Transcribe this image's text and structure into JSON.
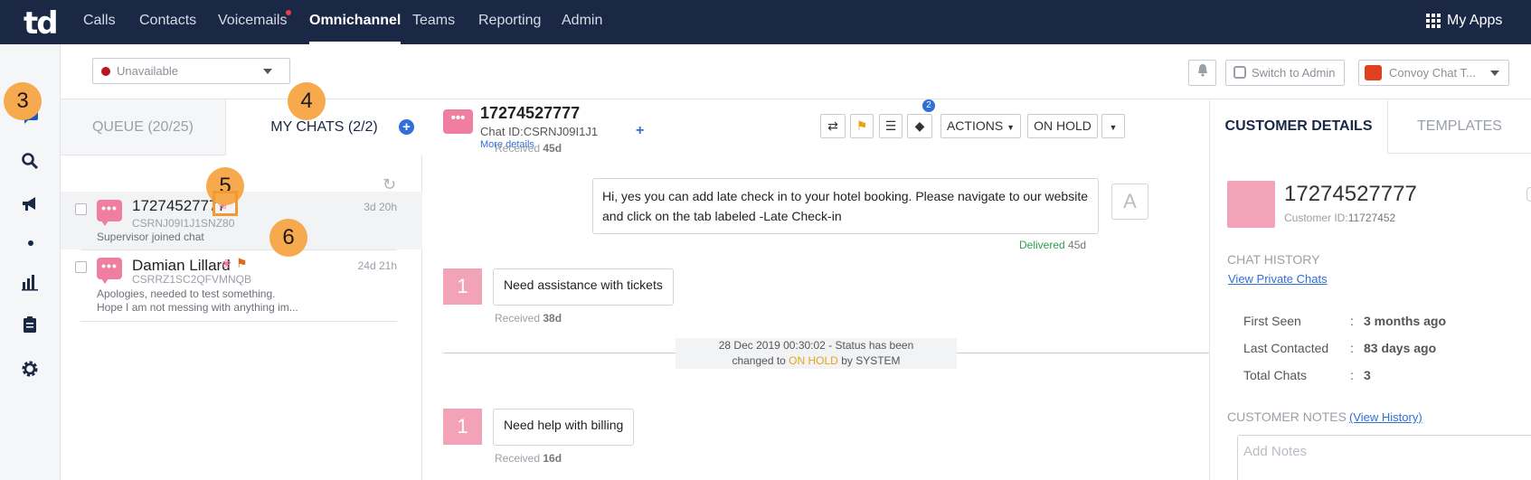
{
  "logo": "td",
  "nav": {
    "items": [
      "Calls",
      "Contacts",
      "Voicemails",
      "Omnichannel",
      "Teams",
      "Reporting",
      "Admin"
    ],
    "active": "Omnichannel",
    "myapps": "My Apps"
  },
  "toolbar": {
    "status": "Unavailable",
    "switch_admin": "Switch to Admin",
    "convoy": "Convoy Chat T..."
  },
  "list": {
    "queue_tab": "QUEUE (20/25)",
    "mychats_tab": "MY CHATS (2/2)",
    "chats": [
      {
        "name": "17274527777",
        "id": "CSRNJ09I1J1SNZ80",
        "preview": "Supervisor joined chat",
        "time": "3d 20h"
      },
      {
        "name": "Damian Lillard",
        "id": "CSRRZ1SC2QFVMNQB",
        "preview_line1": "Apologies, needed to test something.",
        "preview_line2": "Hope I am not messing with anything im...",
        "time": "24d 21h"
      }
    ]
  },
  "conversation": {
    "header": {
      "number": "17274527777",
      "chat_id_label": "Chat ID:",
      "chat_id": "CSRNJ09I1J1",
      "more_details": "More details",
      "tag_badge": "2",
      "actions": "ACTIONS",
      "on_hold": "ON HOLD"
    },
    "received_top": {
      "label": "Received",
      "time": "45d"
    },
    "outgoing": {
      "text": "Hi, yes you can add late check in to your hotel booking. Please navigate to our website and click on the tab labeled -Late Check-in",
      "agent_initial": "A",
      "status": "Delivered",
      "time": "45d"
    },
    "msg1": {
      "num": "1",
      "text": "Need assistance with tickets",
      "received": "Received",
      "time": "38d"
    },
    "status_change": {
      "line1": "28 Dec 2019 00:30:02 - Status has been",
      "prefix": "changed to ",
      "state": "ON HOLD",
      "suffix": " by SYSTEM"
    },
    "msg2": {
      "num": "1",
      "text": "Need help with billing",
      "received": "Received",
      "time": "16d"
    }
  },
  "details": {
    "customer_tab": "CUSTOMER DETAILS",
    "templates_tab": "TEMPLATES",
    "number": "17274527777",
    "customer_id_label": "Customer ID:",
    "customer_id": "11727452",
    "chat_history": "CHAT HISTORY",
    "view_private": "View Private Chats",
    "first_seen_k": "First Seen",
    "first_seen_v": "3 months ago",
    "last_contacted_k": "Last Contacted",
    "last_contacted_v": "83 days ago",
    "total_chats_k": "Total Chats",
    "total_chats_v": "3",
    "colon": ":",
    "notes_label": "CUSTOMER NOTES",
    "view_history": "(View History)",
    "notes_placeholder": "Add Notes"
  },
  "markers": [
    "3",
    "4",
    "5",
    "6"
  ],
  "colors": {
    "nav_bg": "#1a2846",
    "accent_blue": "#2e6fd8",
    "chat_pink": "#ef7ea0",
    "marker_orange": "#f6a94d",
    "on_hold": "#e8a21a",
    "delivered_green": "#2e9e53"
  }
}
